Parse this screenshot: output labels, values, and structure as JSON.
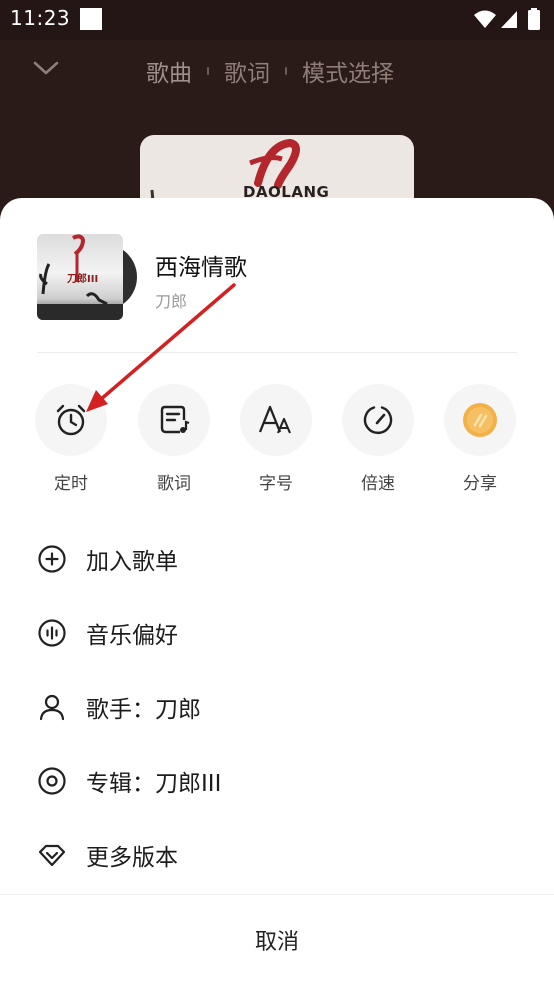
{
  "status_bar": {
    "time": "11:23"
  },
  "player_header": {
    "tabs": [
      {
        "label": "歌曲"
      },
      {
        "label": "歌词"
      },
      {
        "label": "模式选择"
      }
    ],
    "cover_text": "DAOLANG"
  },
  "song": {
    "title": "西海情歌",
    "artist": "刀郎",
    "cover_text": "刀郎III"
  },
  "actions": [
    {
      "label": "定时",
      "icon": "alarm-clock-icon"
    },
    {
      "label": "歌词",
      "icon": "lyrics-note-icon"
    },
    {
      "label": "字号",
      "icon": "font-size-icon"
    },
    {
      "label": "倍速",
      "icon": "speed-gauge-icon"
    },
    {
      "label": "分享",
      "icon": "share-coin-icon"
    }
  ],
  "menu": [
    {
      "label": "加入歌单",
      "icon": "add-circle-icon"
    },
    {
      "label": "音乐偏好",
      "icon": "audio-wave-icon"
    },
    {
      "label": "歌手：刀郎",
      "icon": "person-icon"
    },
    {
      "label": "专辑：刀郎III",
      "icon": "album-disc-icon"
    },
    {
      "label": "更多版本",
      "icon": "diamond-icon"
    }
  ],
  "cancel_label": "取消",
  "colors": {
    "annotation_arrow": "#d32020",
    "share_coin": "#f0a83a",
    "sheet_background": "#ffffff"
  }
}
